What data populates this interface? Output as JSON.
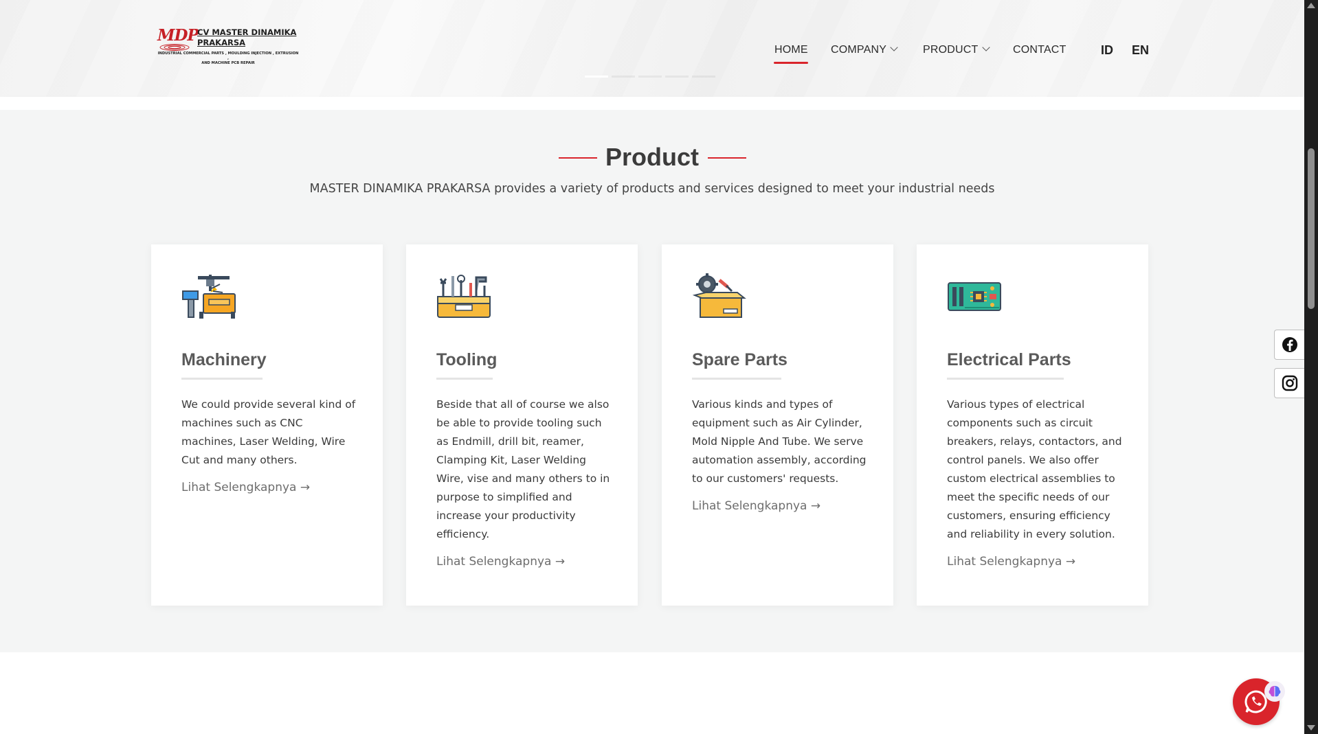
{
  "logo": {
    "mark": "MDP",
    "name_line1": "CV MASTER DINAMIKA",
    "name_line2": "PRAKARSA",
    "tagline_line1": "INDUSTRIAL COMMERCIAL PARTS , MOULDING INJECTION , EXTRUSION ,",
    "tagline_line2": "AND MACHINE PCB REPAIR"
  },
  "nav": {
    "items": [
      {
        "label": "HOME",
        "active": true,
        "dropdown": false
      },
      {
        "label": "COMPANY",
        "active": false,
        "dropdown": true
      },
      {
        "label": "PRODUCT",
        "active": false,
        "dropdown": true
      },
      {
        "label": "CONTACT",
        "active": false,
        "dropdown": false
      }
    ],
    "languages": [
      "ID",
      "EN"
    ],
    "accent_color": "#d9242b"
  },
  "slider": {
    "dot_count": 5,
    "active_index": 0
  },
  "section": {
    "title": "Product",
    "subtitle": "MASTER DINAMIKA PRAKARSA provides a variety of products and services designed to meet your industrial needs"
  },
  "cards": [
    {
      "icon": "machinery-icon",
      "title": "Machinery",
      "description": "We could provide several kind of machines such as CNC machines, Laser Welding, Wire Cut and many others.",
      "link": "Lihat Selengkapnya →"
    },
    {
      "icon": "tooling-icon",
      "title": "Tooling",
      "description": "Beside that all of course we also be able to provide tooling such as Endmill, drill bit, reamer, Clamping Kit, Laser Welding Wire, vise and many others to in purpose to simplified and increase your productivity efficiency.",
      "link": "Lihat Selengkapnya →"
    },
    {
      "icon": "spare-parts-icon",
      "title": "Spare Parts",
      "description": "Various kinds and types of equipment such as Air Cylinder, Mold Nipple And Tube. We serve automation assembly, according to our customers' requests.",
      "link": "Lihat Selengkapnya →"
    },
    {
      "icon": "circuit-board-icon",
      "title": "Electrical Parts",
      "description": "Various types of electrical components such as circuit breakers, relays, contactors, and control panels. We also offer custom electrical assemblies to meet the specific needs of our customers, ensuring efficiency and reliability in every solution.",
      "link": "Lihat Selengkapnya →"
    }
  ],
  "social": [
    "facebook-icon",
    "instagram-icon"
  ],
  "chat": {
    "icon": "whatsapp-icon",
    "badge_icon": "brain-icon"
  }
}
